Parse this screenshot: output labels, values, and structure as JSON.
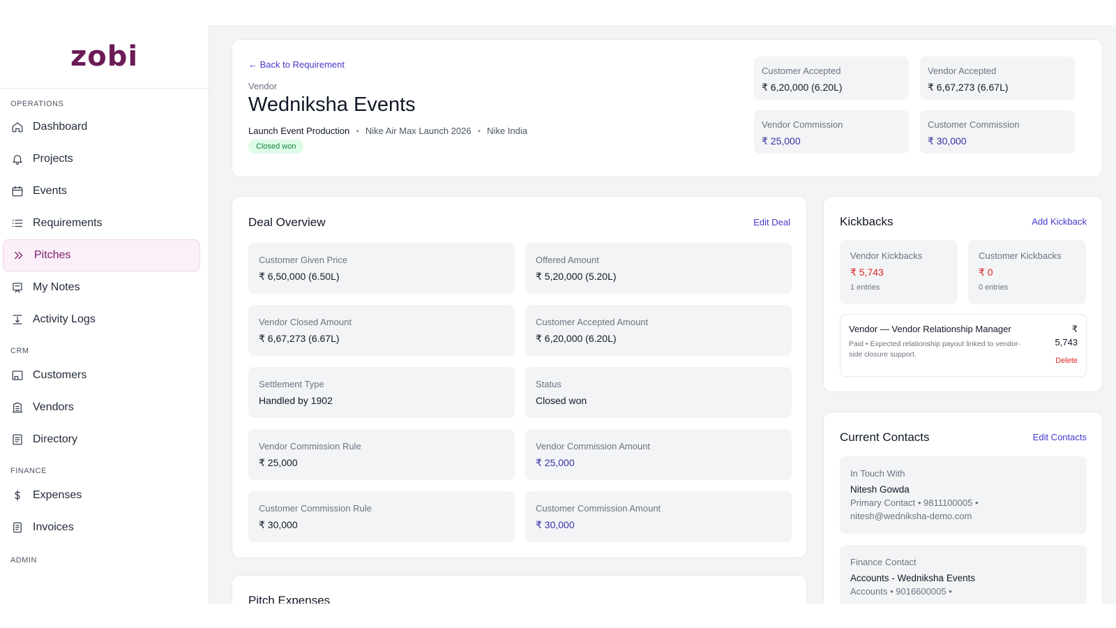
{
  "app": {
    "logo": "zobi"
  },
  "sidebar": {
    "sections": [
      {
        "label": "OPERATIONS"
      },
      {
        "label": "CRM"
      },
      {
        "label": "FINANCE"
      },
      {
        "label": "ADMIN"
      }
    ],
    "items": [
      {
        "label": "Dashboard",
        "icon": "home-icon"
      },
      {
        "label": "Projects",
        "icon": "bell-icon"
      },
      {
        "label": "Events",
        "icon": "calendar-icon"
      },
      {
        "label": "Requirements",
        "icon": "list-icon"
      },
      {
        "label": "Pitches",
        "icon": "double-chevron-icon",
        "active": true
      },
      {
        "label": "My Notes",
        "icon": "note-icon"
      },
      {
        "label": "Activity Logs",
        "icon": "log-icon"
      },
      {
        "label": "Customers",
        "icon": "store-icon"
      },
      {
        "label": "Vendors",
        "icon": "building-icon"
      },
      {
        "label": "Directory",
        "icon": "directory-icon"
      },
      {
        "label": "Expenses",
        "icon": "dollar-icon"
      },
      {
        "label": "Invoices",
        "icon": "invoice-icon"
      }
    ]
  },
  "header": {
    "back_link": "← Back to Requirement",
    "entity_type": "Vendor",
    "title": "Wedniksha Events",
    "meta": [
      "Launch Event Production",
      "Nike Air Max Launch 2026",
      "Nike India"
    ],
    "status": "Closed won",
    "summary": [
      {
        "label": "Customer Accepted",
        "value": "₹ 6,20,000 (6.20L)"
      },
      {
        "label": "Vendor Accepted",
        "value": "₹ 6,67,273 (6.67L)"
      },
      {
        "label": "Vendor Commission",
        "value": "₹ 25,000"
      },
      {
        "label": "Customer Commission",
        "value": "₹ 30,000"
      }
    ]
  },
  "deal": {
    "title": "Deal Overview",
    "action": "Edit Deal",
    "fields": [
      {
        "label": "Customer Given Price",
        "value": "₹ 6,50,000 (6.50L)"
      },
      {
        "label": "Offered Amount",
        "value": "₹ 5,20,000 (5.20L)"
      },
      {
        "label": "Vendor Closed Amount",
        "value": "₹ 6,67,273 (6.67L)"
      },
      {
        "label": "Customer Accepted Amount",
        "value": "₹ 6,20,000 (6.20L)"
      },
      {
        "label": "Settlement Type",
        "value": "Handled by 1902"
      },
      {
        "label": "Status",
        "value": "Closed won"
      },
      {
        "label": "Vendor Commission Rule",
        "value": "₹ 25,000"
      },
      {
        "label": "Vendor Commission Amount",
        "value": "₹ 25,000"
      },
      {
        "label": "Customer Commission Rule",
        "value": "₹ 30,000"
      },
      {
        "label": "Customer Commission Amount",
        "value": "₹ 30,000"
      }
    ]
  },
  "expenses": {
    "title": "Pitch Expenses"
  },
  "kickbacks": {
    "title": "Kickbacks",
    "action": "Add Kickback",
    "stats": [
      {
        "label": "Vendor Kickbacks",
        "value": "₹ 5,743",
        "entries": "1 entries"
      },
      {
        "label": "Customer Kickbacks",
        "value": "₹ 0",
        "entries": "0 entries"
      }
    ],
    "entry": {
      "title": "Vendor — Vendor Relationship Manager",
      "currency": "₹",
      "amount": "5,743",
      "status": "Paid",
      "note": "Expected relationship payout linked to vendor-side closure support.",
      "delete": "Delete"
    }
  },
  "contacts": {
    "title": "Current Contacts",
    "action": "Edit Contacts",
    "items": [
      {
        "label": "In Touch With",
        "name": "Nitesh Gowda",
        "role": "Primary Contact",
        "phone": "9811100005",
        "email": "nitesh@wedniksha-demo.com"
      },
      {
        "label": "Finance Contact",
        "name": "Accounts - Wedniksha Events",
        "role": "Accounts",
        "phone": "9016600005"
      }
    ]
  }
}
